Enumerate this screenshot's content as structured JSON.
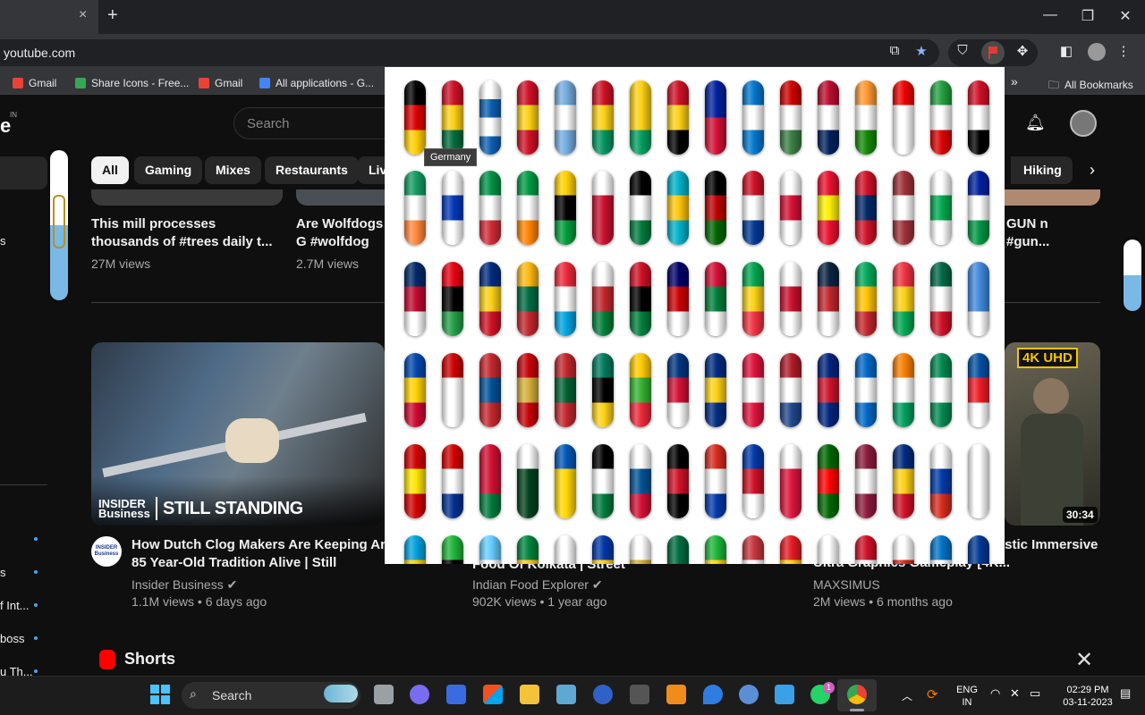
{
  "browser": {
    "url": "youtube.com",
    "tab_close": "×",
    "new_tab": "+",
    "win_min": "—",
    "win_max": "❐",
    "win_close": "✕"
  },
  "bookmarks": {
    "items": [
      {
        "label": "Gmail",
        "color": "#ea4335"
      },
      {
        "label": "Share Icons - Free...",
        "color": "#34a853"
      },
      {
        "label": "Gmail",
        "color": "#ea4335"
      },
      {
        "label": "All applications - G...",
        "color": "#4285f4"
      }
    ],
    "more": "»",
    "all": "All Bookmarks"
  },
  "youtube": {
    "logo": "e",
    "logo_country": "IN",
    "search_placeholder": "Search",
    "chips": [
      "All",
      "Gaming",
      "Mixes",
      "Restaurants",
      "Liv",
      "Hiking"
    ],
    "sidebar_texts": [
      "s",
      "s",
      "f Int...",
      "boss",
      "u Th..."
    ],
    "videos_row1": [
      {
        "title": "This mill processes thousands of #trees daily t...",
        "views": "27M views"
      },
      {
        "title": "Are Wolfdogs G #wolfdog #pets",
        "views": "2.7M views"
      },
      {
        "title": "GUN n #gun...",
        "views": ""
      }
    ],
    "videos_row2": [
      {
        "title": "How Dutch Clog Makers Are Keeping An 85 Year-Old Tradition Alive | Still Standing",
        "channel": "Insider Business",
        "meta": "1.1M views • 6 days ago",
        "overlay_brand": "INSIDER Business",
        "overlay_text": "STILL STANDING",
        "avatar_text": "INSIDER Business"
      },
      {
        "title": "Food Of Kolkata | Street Food India",
        "channel": "Indian Food Explorer",
        "meta": "902K views • 1 year ago"
      },
      {
        "title": "istic Immersive Ultra Graphics Gameplay [4K...",
        "channel": "MAXSIMUS",
        "meta": "2M views • 6 months ago",
        "duration": "30:34",
        "badge": "4K UHD"
      }
    ],
    "shorts": "Shorts"
  },
  "popup": {
    "tooltip": "Germany"
  },
  "taskbar": {
    "search": "Search",
    "lang": "ENG",
    "region": "IN",
    "time": "02:29 PM",
    "date": "03-11-2023",
    "whatsapp_badge": "1"
  }
}
